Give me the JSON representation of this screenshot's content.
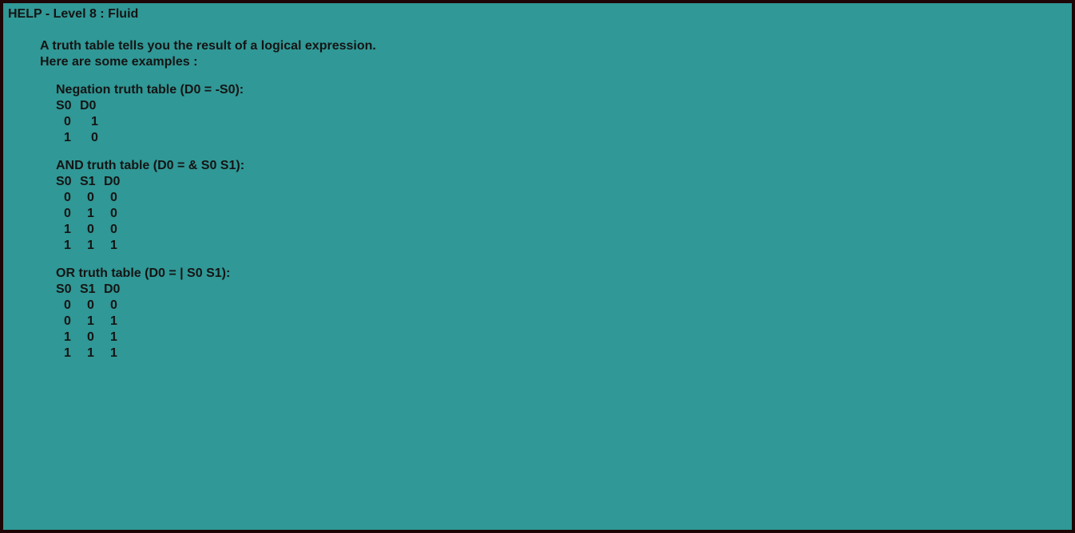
{
  "window": {
    "title": "HELP - Level 8 : Fluid"
  },
  "intro": {
    "line1": "A truth table tells you the result of a logical expression.",
    "line2": "Here are some examples :"
  },
  "tables": [
    {
      "title": "Negation truth table (D0 = -S0):",
      "headers": [
        "S0",
        "D0"
      ],
      "rows": [
        [
          "0",
          "1"
        ],
        [
          "1",
          "0"
        ]
      ]
    },
    {
      "title": "AND truth table (D0 = & S0 S1):",
      "headers": [
        "S0",
        "S1",
        "D0"
      ],
      "rows": [
        [
          "0",
          "0",
          "0"
        ],
        [
          "0",
          "1",
          "0"
        ],
        [
          "1",
          "0",
          "0"
        ],
        [
          "1",
          "1",
          "1"
        ]
      ]
    },
    {
      "title": "OR truth table (D0 = | S0 S1):",
      "headers": [
        "S0",
        "S1",
        "D0"
      ],
      "rows": [
        [
          "0",
          "0",
          "0"
        ],
        [
          "0",
          "1",
          "1"
        ],
        [
          "1",
          "0",
          "1"
        ],
        [
          "1",
          "1",
          "1"
        ]
      ]
    }
  ],
  "colors": {
    "background": "#309896",
    "border": "#1e0606",
    "text": "#141414"
  }
}
